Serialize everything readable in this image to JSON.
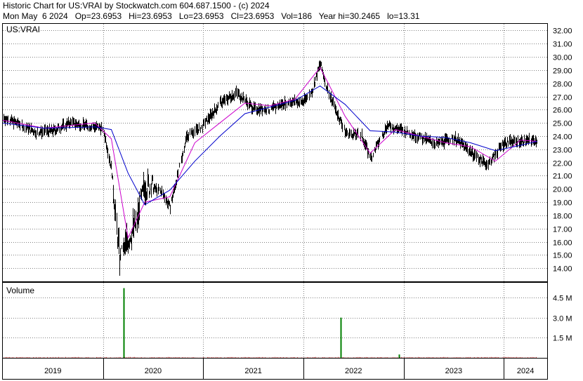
{
  "header": {
    "line1": "Historic Chart for US:VRAI by Stockwatch.com 604.687.1500 - (c) 2024",
    "line2": "Mon May  6 2024   Op=23.6953   Hi=23.6953   Lo=23.6953   Cl=23.6953   Vol=186   Year hi=30.2465   lo=13.31"
  },
  "colors": {
    "price_bars": "#000000",
    "ma_short": "#cc00cc",
    "ma_long": "#0000cc",
    "volume": "#008000",
    "grid": "#808080"
  },
  "chart_data": [
    {
      "type": "line",
      "title": "US:VRAI",
      "x_ticks": [
        "2019",
        "2020",
        "2021",
        "2022",
        "2023",
        "2024"
      ],
      "x_range": [
        "2019-01",
        "2024-05"
      ],
      "y_ticks": [
        "14.00",
        "15.00",
        "16.00",
        "17.00",
        "18.00",
        "19.00",
        "20.00",
        "21.00",
        "22.00",
        "23.00",
        "24.00",
        "25.00",
        "26.00",
        "27.00",
        "28.00",
        "29.00",
        "30.00",
        "31.00",
        "32.00"
      ],
      "ylim": [
        13,
        32.5
      ],
      "grid": true,
      "series": [
        {
          "style": "ohlc-bars",
          "x": [
            "2019-01",
            "2019-03",
            "2019-05",
            "2019-07",
            "2019-09",
            "2019-11",
            "2020-01",
            "2020-02",
            "2020-03",
            "2020-04",
            "2020-05",
            "2020-06",
            "2020-08",
            "2020-09",
            "2020-11",
            "2021-01",
            "2021-03",
            "2021-05",
            "2021-07",
            "2021-09",
            "2021-11",
            "2022-01",
            "2022-02",
            "2022-03",
            "2022-04",
            "2022-06",
            "2022-08",
            "2022-09",
            "2022-11",
            "2023-01",
            "2023-03",
            "2023-05",
            "2023-07",
            "2023-09",
            "2023-11",
            "2024-01",
            "2024-03",
            "2024-05"
          ],
          "values": [
            25.4,
            24.9,
            24.3,
            24.4,
            25.0,
            24.8,
            24.6,
            21.5,
            14.5,
            16.2,
            17.5,
            20.3,
            19.8,
            18.6,
            24.0,
            24.8,
            26.5,
            27.3,
            26.1,
            26.0,
            26.6,
            26.6,
            27.4,
            29.5,
            27.2,
            24.3,
            24.0,
            22.3,
            24.8,
            24.4,
            23.9,
            23.4,
            23.9,
            22.8,
            21.8,
            23.5,
            23.6,
            23.7
          ]
        },
        {
          "style": "moving-average-short",
          "x": [
            "2019-01",
            "2019-06",
            "2019-12",
            "2020-02",
            "2020-04",
            "2020-06",
            "2020-09",
            "2020-12",
            "2021-03",
            "2021-06",
            "2021-09",
            "2021-12",
            "2022-03",
            "2022-06",
            "2022-09",
            "2022-12",
            "2023-03",
            "2023-06",
            "2023-09",
            "2023-12",
            "2024-03",
            "2024-05"
          ],
          "values": [
            25.2,
            24.6,
            25.0,
            23.8,
            16.3,
            19.0,
            19.4,
            23.5,
            25.0,
            26.5,
            26.3,
            26.8,
            29.2,
            25.5,
            22.7,
            24.5,
            24.0,
            23.5,
            23.2,
            22.1,
            23.7,
            23.6
          ]
        },
        {
          "style": "moving-average-long",
          "x": [
            "2019-01",
            "2019-06",
            "2019-12",
            "2020-02",
            "2020-04",
            "2020-06",
            "2020-09",
            "2020-12",
            "2021-03",
            "2021-06",
            "2021-09",
            "2021-12",
            "2022-03",
            "2022-06",
            "2022-09",
            "2022-12",
            "2023-03",
            "2023-06",
            "2023-09",
            "2023-12",
            "2024-03",
            "2024-05"
          ],
          "values": [
            25.0,
            24.6,
            24.7,
            24.5,
            21.2,
            18.8,
            19.9,
            22.1,
            24.0,
            25.7,
            26.2,
            26.7,
            27.8,
            26.4,
            24.4,
            24.3,
            24.0,
            23.9,
            23.5,
            22.9,
            23.3,
            23.6
          ]
        }
      ]
    },
    {
      "type": "bar",
      "title": "Volume",
      "y_ticks": [
        "1.5 M",
        "3.0 M",
        "4.5 M"
      ],
      "ylim": [
        0,
        5.6
      ],
      "x": [
        "2020-03",
        "2022-05",
        "2022-12"
      ],
      "values": [
        5.2,
        3.0,
        0.25
      ],
      "baseline_note_values": [
        0.05
      ]
    }
  ]
}
